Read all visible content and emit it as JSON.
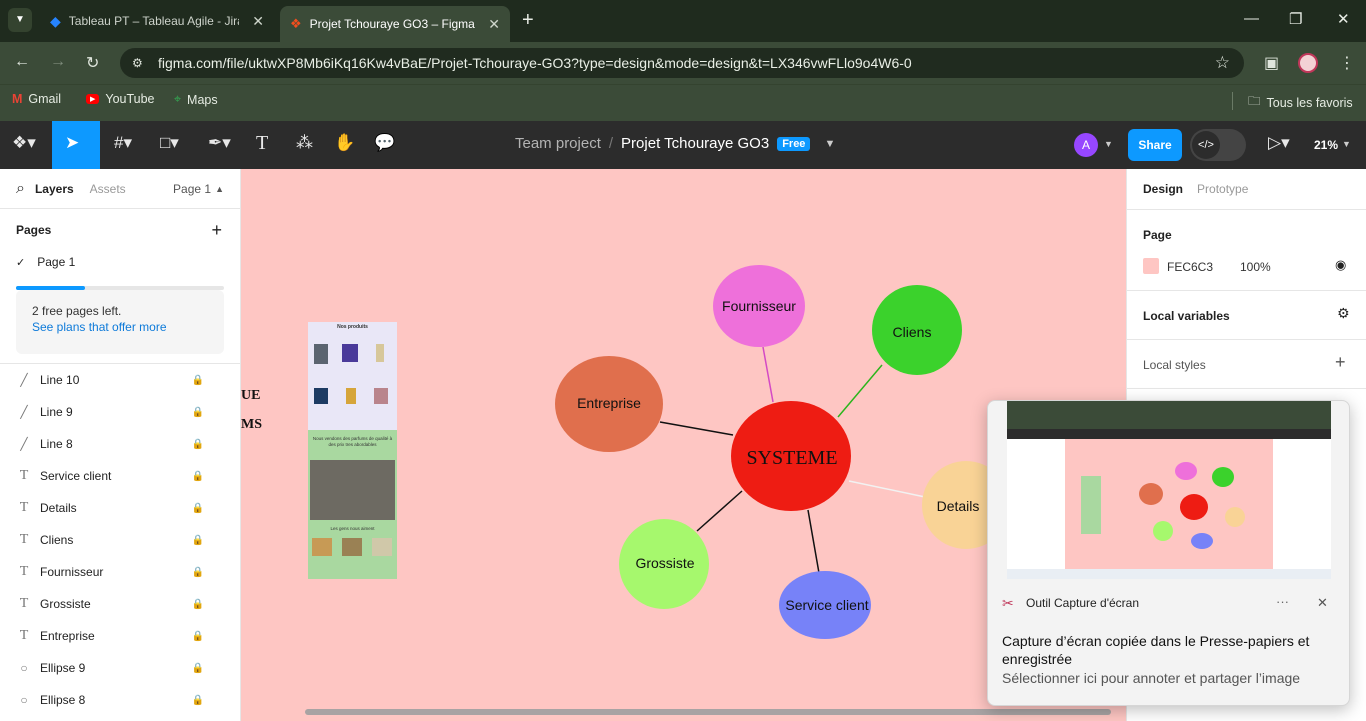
{
  "browser": {
    "tabs": [
      {
        "label": "Tableau PT – Tableau Agile - Jira"
      },
      {
        "label": "Projet Tchouraye GO3 – Figma"
      }
    ],
    "url": "figma.com/file/uktwXP8Mb6iKq16Kw4vBaE/Projet-Tchouraye-GO3?type=design&mode=design&t=LX346vwFLlo9o4W6-0",
    "bookmarks": [
      "Gmail",
      "YouTube",
      "Maps"
    ],
    "all_bookmarks": "Tous les favoris"
  },
  "figma": {
    "team": "Team project",
    "file": "Projet Tchouraye GO3",
    "plan_badge": "Free",
    "avatar_initial": "A",
    "share": "Share",
    "zoom": "21%"
  },
  "left": {
    "tabs": {
      "layers": "Layers",
      "assets": "Assets",
      "page_select": "Page 1"
    },
    "pages_title": "Pages",
    "current_page": "Page 1",
    "info_text": "2 free pages left.",
    "info_link": "See plans that offer more",
    "layers": [
      {
        "name": "Line 10",
        "icon": "line-icon"
      },
      {
        "name": "Line 9",
        "icon": "line-icon"
      },
      {
        "name": "Line 8",
        "icon": "line-icon"
      },
      {
        "name": "Service client",
        "icon": "text-icon"
      },
      {
        "name": "Details",
        "icon": "text-icon"
      },
      {
        "name": "Cliens",
        "icon": "text-icon"
      },
      {
        "name": "Fournisseur",
        "icon": "text-icon"
      },
      {
        "name": "Grossiste",
        "icon": "text-icon"
      },
      {
        "name": "Entreprise",
        "icon": "text-icon"
      },
      {
        "name": "Ellipse 9",
        "icon": "ellipse-icon"
      },
      {
        "name": "Ellipse 8",
        "icon": "ellipse-icon"
      }
    ]
  },
  "canvas": {
    "bg_color": "#FEC6C3",
    "partial_text": [
      "UE",
      "MS"
    ],
    "frame": {
      "heading": "Nos produits",
      "tagline": "Nous vendons des parfums de qualité à des prix tres abordables",
      "footer_heading": "Les gens nous aiment"
    },
    "diagram": {
      "center": {
        "label": "SYSTEME",
        "color": "#EE1C13"
      },
      "nodes": [
        {
          "label": "Fournisseur",
          "color": "#EE70DA"
        },
        {
          "label": "Cliens",
          "color": "#3BD22C"
        },
        {
          "label": "Entreprise",
          "color": "#E06F4D"
        },
        {
          "label": "Details",
          "color": "#F9D396"
        },
        {
          "label": "Grossiste",
          "color": "#A6F86D"
        },
        {
          "label": "Service client",
          "color": "#7782F8"
        }
      ]
    }
  },
  "right": {
    "tabs": {
      "design": "Design",
      "prototype": "Prototype"
    },
    "page_title": "Page",
    "page_color": "FEC6C3",
    "page_opacity": "100%",
    "local_variables": "Local variables",
    "local_styles": "Local styles"
  },
  "toast": {
    "app": "Outil Capture d'écran",
    "title": "Capture d’écran copiée dans le Presse-papiers et enregistrée",
    "subtitle": "Sélectionner ici pour annoter et partager l’image",
    "more": "···"
  },
  "icons": {
    "close": "✕",
    "plus": "+",
    "back": "←",
    "forward": "→",
    "reload": "↻",
    "star": "☆",
    "check": "✓",
    "search": "⌕",
    "eye": "◉",
    "lock": "🔒"
  }
}
